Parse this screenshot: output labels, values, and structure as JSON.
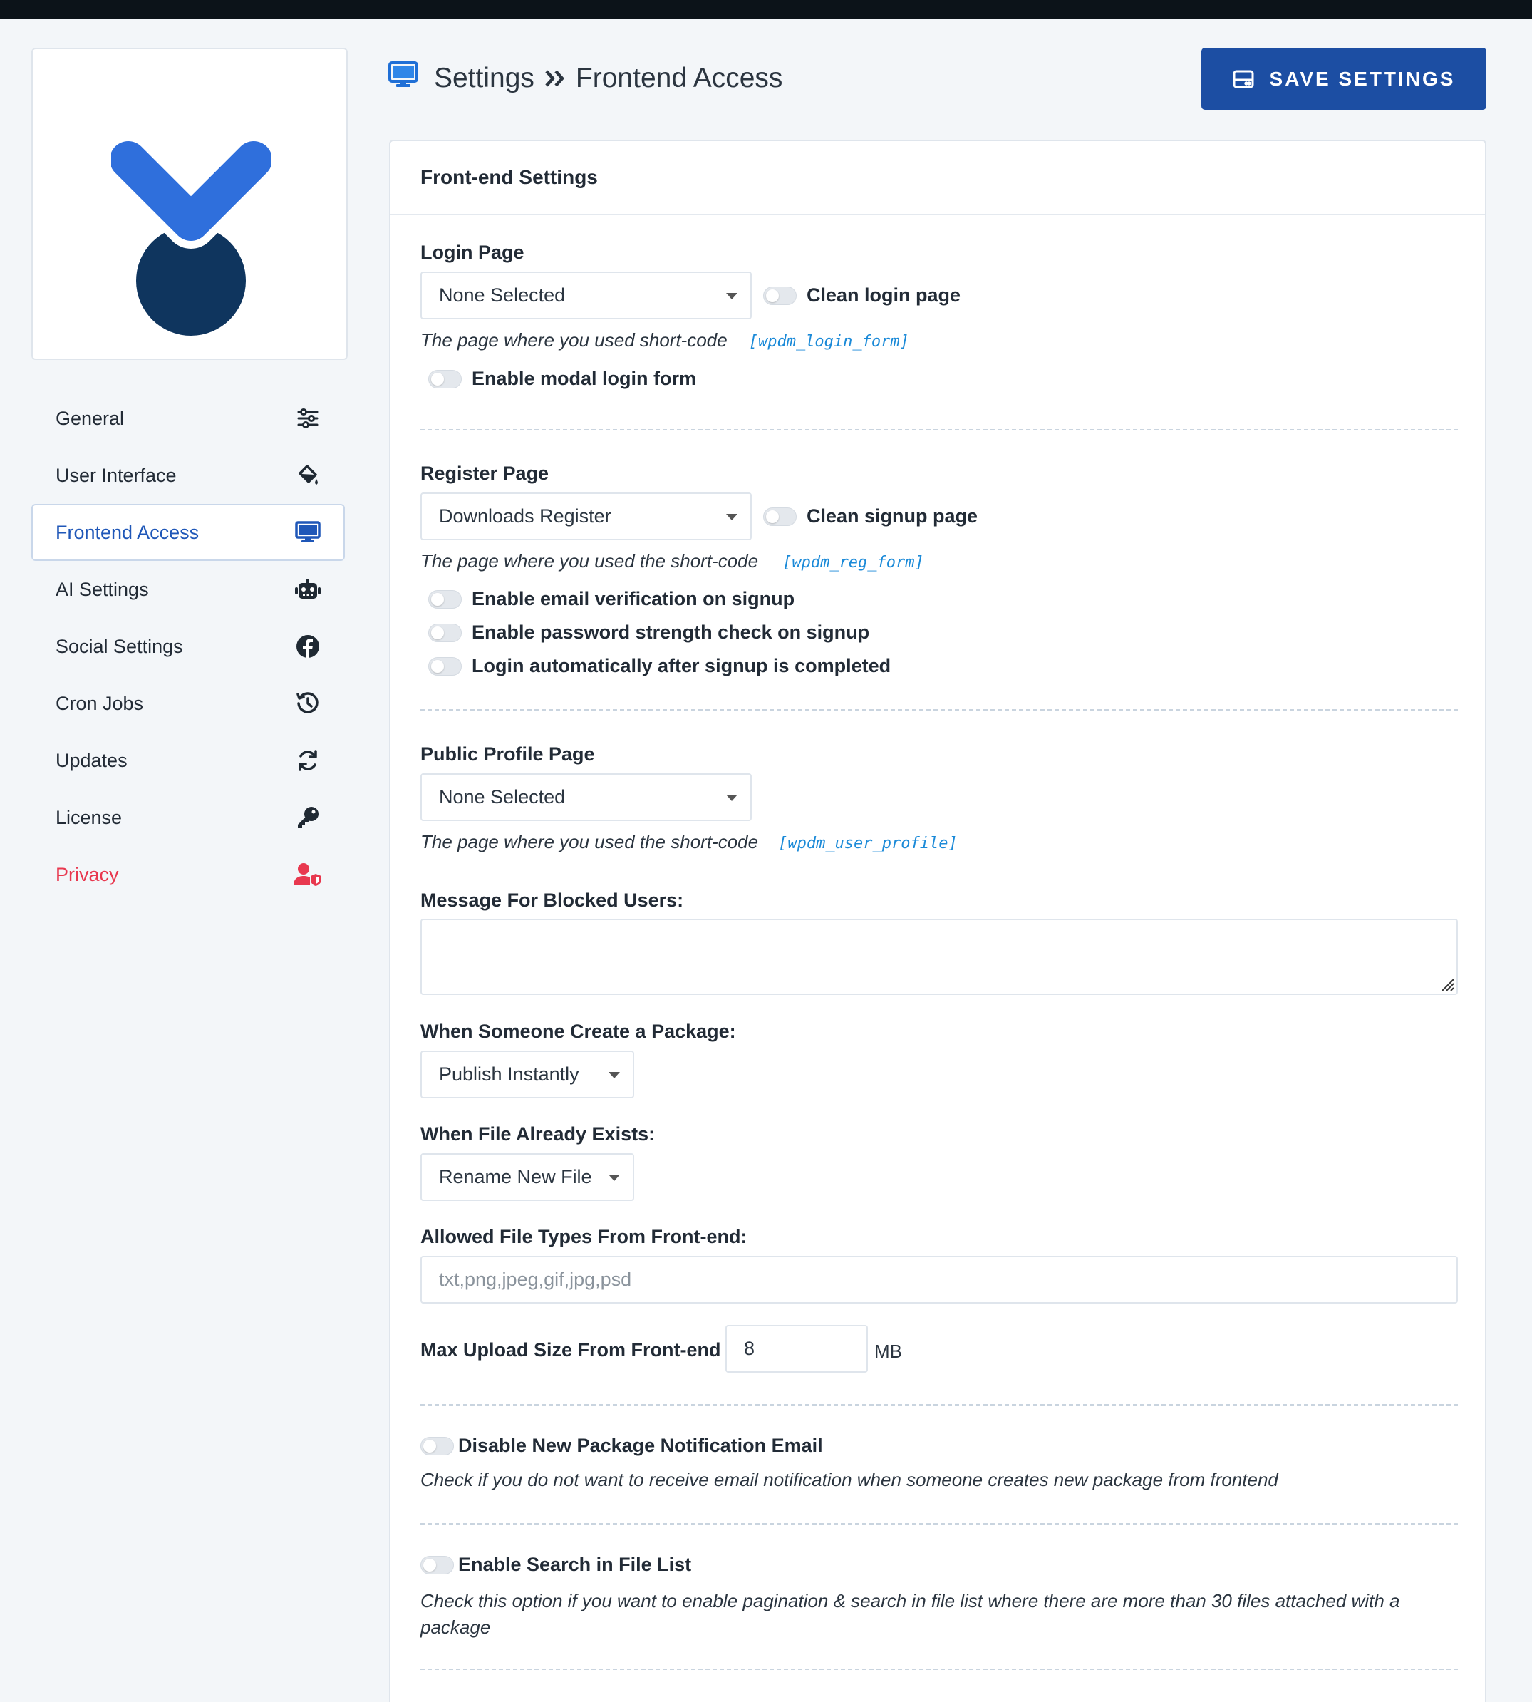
{
  "sidebar": {
    "items": [
      {
        "label": "General",
        "icon": "sliders-icon"
      },
      {
        "label": "User Interface",
        "icon": "paint-bucket-icon"
      },
      {
        "label": "Frontend Access",
        "icon": "desktop-icon",
        "active": true
      },
      {
        "label": "AI Settings",
        "icon": "robot-icon"
      },
      {
        "label": "Social Settings",
        "icon": "facebook-icon"
      },
      {
        "label": "Cron Jobs",
        "icon": "history-icon"
      },
      {
        "label": "Updates",
        "icon": "sync-icon"
      },
      {
        "label": "License",
        "icon": "key-icon"
      },
      {
        "label": "Privacy",
        "icon": "user-shield-icon",
        "color": "#e8384f"
      }
    ]
  },
  "header": {
    "crumb_root": "Settings",
    "crumb_current": "Frontend Access",
    "save_label": "SAVE SETTINGS"
  },
  "panel": {
    "title": "Front-end Settings",
    "login": {
      "label": "Login Page",
      "select": "None Selected",
      "clean_toggle": "Clean login page",
      "help": "The page where you used short-code",
      "code": "[wpdm_login_form]",
      "modal_toggle": "Enable modal login form"
    },
    "register": {
      "label": "Register Page",
      "select": "Downloads Register",
      "clean_toggle": "Clean signup page",
      "help": "The page where you used the short-code",
      "code": "[wpdm_reg_form]",
      "email_verify": "Enable email verification on signup",
      "password_strength": "Enable password strength check on signup",
      "auto_login": "Login automatically after signup is completed"
    },
    "profile": {
      "label": "Public Profile Page",
      "select": "None Selected",
      "help": "The page where you used the short-code",
      "code": "[wpdm_user_profile]"
    },
    "blocked": {
      "label": "Message For Blocked Users:",
      "value": ""
    },
    "create_package": {
      "label": "When Someone Create a Package:",
      "select": "Publish Instantly"
    },
    "file_exists": {
      "label": "When File Already Exists:",
      "select": "Rename New File"
    },
    "file_types": {
      "label": "Allowed File Types From Front-end:",
      "placeholder": "txt,png,jpeg,gif,jpg,psd"
    },
    "max_upload": {
      "label": "Max Upload Size From Front-end",
      "value": "8",
      "unit": "MB"
    },
    "disable_notify": {
      "toggle": "Disable New Package Notification Email",
      "help": "Check if you do not want to receive email notification when someone creates new package from frontend"
    },
    "enable_search": {
      "toggle": "Enable Search in File List",
      "help": "Check this option if you want to enable pagination & search in file list where there are more than 30 files attached with a package"
    }
  },
  "colors": {
    "accent": "#1c4ea3",
    "active_text": "#1f57b8",
    "danger": "#e8384f",
    "code": "#1b8ad8",
    "logo_light": "#2f6fdc",
    "logo_dark": "#0f355e"
  }
}
